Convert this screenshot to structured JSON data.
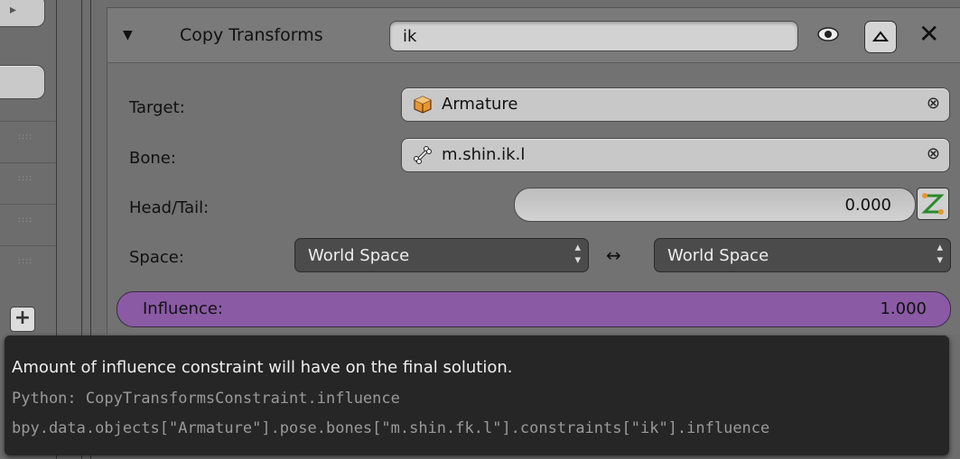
{
  "header": {
    "title": "Copy Transforms",
    "name_value": "ik"
  },
  "fields": {
    "target_label": "Target:",
    "target_value": "Armature",
    "bone_label": "Bone:",
    "bone_value": "m.shin.ik.l",
    "headtail_label": "Head/Tail:",
    "headtail_value": "0.000",
    "space_label": "Space:",
    "owner_space": "World Space",
    "target_space": "World Space",
    "influence_label": "Influence:",
    "influence_value": "1.000",
    "clear_glyph": "⊗"
  },
  "tooltip": {
    "description": "Amount of influence constraint will have on the final solution.",
    "python": "Python: CopyTransformsConstraint.influence",
    "path": "bpy.data.objects[\"Armature\"].pose.bones[\"m.shin.fk.l\"].constraints[\"ik\"].influence"
  },
  "icons": [
    "disclosure-triangle-icon",
    "eye-icon",
    "move-up-icon",
    "close-icon",
    "object-cube-icon",
    "bone-icon",
    "clear-icon",
    "keyframe-anim-icon",
    "swap-arrows-icon",
    "plus-icon"
  ],
  "colors": {
    "influence": "#8a5aa5",
    "tooltip_bg": "#262626",
    "panel_bg": "#727272",
    "dropdown_bg": "#4b4b4b"
  }
}
